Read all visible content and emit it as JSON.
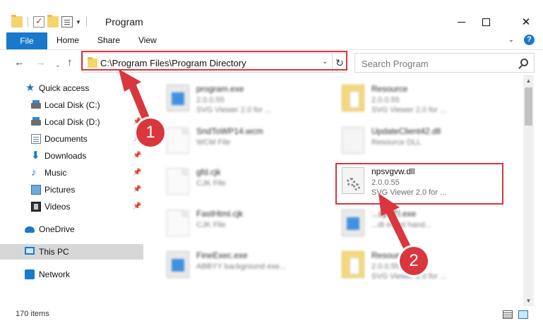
{
  "window": {
    "title": "Program",
    "minimize": "—",
    "maximize": "☐",
    "close": "✕"
  },
  "ribbon": {
    "tabs": [
      "File",
      "Home",
      "Share",
      "View"
    ],
    "collapse": "⌄",
    "help": "?"
  },
  "address": {
    "back": "←",
    "forward": "→",
    "recent": "⌄",
    "up": "↑",
    "path": "C:\\Program Files\\Program Directory",
    "dropdown": "⌄",
    "refresh": "↻",
    "search_placeholder": "Search Program"
  },
  "sidebar": {
    "items": [
      {
        "label": "Quick access",
        "icon": "star-icon",
        "pinned": false
      },
      {
        "label": "Local Disk (C:)",
        "icon": "drive-icon",
        "pinned": false
      },
      {
        "label": "Local Disk (D:)",
        "icon": "drive-icon",
        "pinned": true
      },
      {
        "label": "Documents",
        "icon": "documents-icon",
        "pinned": true
      },
      {
        "label": "Downloads",
        "icon": "download-icon",
        "pinned": true
      },
      {
        "label": "Music",
        "icon": "music-icon",
        "pinned": true
      },
      {
        "label": "Pictures",
        "icon": "pictures-icon",
        "pinned": true
      },
      {
        "label": "Videos",
        "icon": "videos-icon",
        "pinned": true
      },
      {
        "label": "OneDrive",
        "icon": "cloud-icon",
        "pinned": false
      },
      {
        "label": "This PC",
        "icon": "computer-icon",
        "pinned": false,
        "selected": true
      },
      {
        "label": "Network",
        "icon": "network-icon",
        "pinned": false
      }
    ],
    "pin_glyph": "📌"
  },
  "files": {
    "left": [
      {
        "name": "program.exe",
        "line1": "2.0.0.55",
        "line2": "SVG Viewer 2.0 for ...",
        "icon": "exe-icon"
      },
      {
        "name": "SndToWP14.wcm",
        "line1": "WCM File",
        "line2": "",
        "icon": "document-icon"
      },
      {
        "name": "gfd.cjk",
        "line1": "CJK File",
        "line2": "",
        "icon": "document-icon"
      },
      {
        "name": "FastHtml.cjk",
        "line1": "CJK File",
        "line2": "",
        "icon": "document-icon"
      },
      {
        "name": "FineExec.exe",
        "line1": "ABBYY background exe...",
        "line2": "",
        "icon": "exe-icon"
      }
    ],
    "right": [
      {
        "name": "Resource",
        "line1": "2.0.0.55",
        "line2": "SVG Viewer 2.0 for ...",
        "icon": "folder-icon"
      },
      {
        "name": "UpdateClient42.dll",
        "line1": "Resource DLL",
        "line2": "",
        "icon": "dll-icon"
      },
      {
        "name": "npsvgvw.dll",
        "line1": "2.0.0.55",
        "line2": "SVG Viewer 2.0 for ...",
        "icon": "dll-gear-icon",
        "highlighted": true
      },
      {
        "name": "...sySTI.exe",
        "line1": "...dt event hand...",
        "line2": "",
        "icon": "exe-icon"
      },
      {
        "name": "Resource",
        "line1": "2.0.0.55",
        "line2": "SVG Viewer 2.0 for ...",
        "icon": "folder-icon"
      }
    ]
  },
  "status": {
    "count": "170 items"
  },
  "annotations": {
    "step1": "1",
    "step2": "2",
    "color": "#d9363e"
  },
  "colors": {
    "accent": "#1979ca",
    "highlight": "#d9363e",
    "selection": "#d7d7d7"
  }
}
